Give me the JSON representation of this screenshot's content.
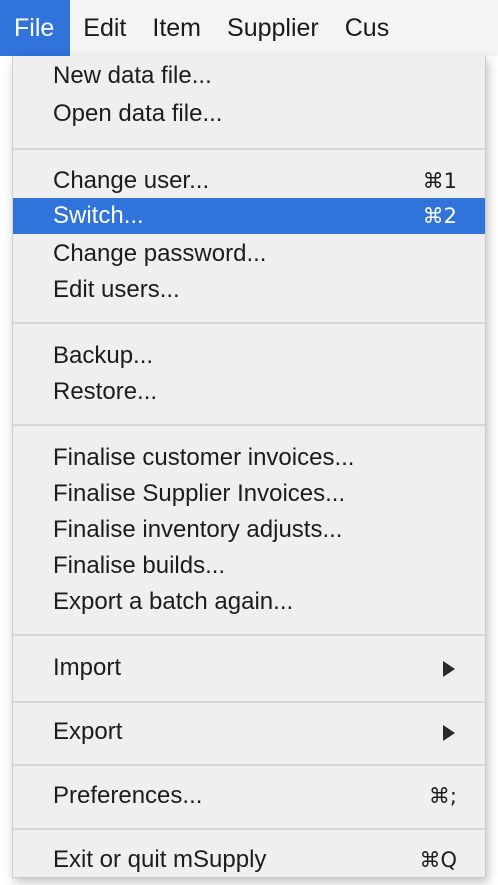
{
  "menubar": {
    "items": [
      "File",
      "Edit",
      "Item",
      "Supplier",
      "Cus"
    ]
  },
  "file_menu": {
    "new_data_file": "New data file...",
    "open_data_file": "Open data file...",
    "change_user": "Change user...",
    "change_user_shortcut": "⌘1",
    "switch": "Switch...",
    "switch_shortcut": "⌘2",
    "change_password": "Change password...",
    "edit_users": "Edit users...",
    "backup": "Backup...",
    "restore": "Restore...",
    "finalise_customer_invoices": "Finalise customer invoices...",
    "finalise_supplier_invoices": "Finalise Supplier Invoices...",
    "finalise_inventory_adjusts": "Finalise inventory adjusts...",
    "finalise_builds": "Finalise builds...",
    "export_batch_again": "Export a batch again...",
    "import": "Import",
    "export": "Export",
    "preferences": "Preferences...",
    "preferences_shortcut": "⌘;",
    "exit": "Exit or quit mSupply",
    "exit_shortcut": "⌘Q"
  },
  "colors": {
    "highlight": "#2f73db",
    "menu_background": "#efefef"
  }
}
